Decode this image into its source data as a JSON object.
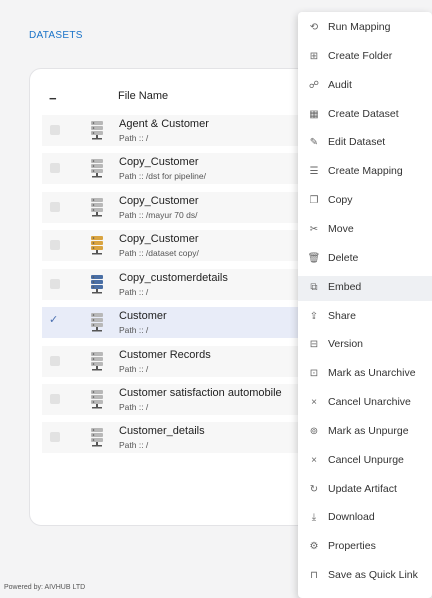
{
  "section_title": "DATASETS",
  "table": {
    "header_toggle": "−",
    "column_header": "File Name",
    "rows": [
      {
        "name": "Agent & Customer",
        "path": "Path :: /",
        "selected": false,
        "icon": "database-icon",
        "icon_color": "#b8b8b8"
      },
      {
        "name": "Copy_Customer",
        "path": "Path :: /dst for pipeline/",
        "selected": false,
        "icon": "database-icon",
        "icon_color": "#b8b8b8"
      },
      {
        "name": "Copy_Customer",
        "path": "Path :: /mayur 70 ds/",
        "selected": false,
        "icon": "database-icon",
        "icon_color": "#b8b8b8"
      },
      {
        "name": "Copy_Customer",
        "path": "Path :: /dataset copy/",
        "selected": false,
        "icon": "database-icon",
        "icon_color": "#d9a441"
      },
      {
        "name": "Copy_customerdetails",
        "path": "Path :: /",
        "selected": false,
        "icon": "database-icon",
        "icon_color": "#4a6fa5"
      },
      {
        "name": "Customer",
        "path": "Path :: /",
        "selected": true,
        "icon": "database-icon",
        "icon_color": "#b8b8b8"
      },
      {
        "name": "Customer Records",
        "path": "Path :: /",
        "selected": false,
        "icon": "database-icon",
        "icon_color": "#b8b8b8"
      },
      {
        "name": "Customer satisfaction automobile",
        "path": "Path :: /",
        "selected": false,
        "icon": "database-icon",
        "icon_color": "#b8b8b8"
      },
      {
        "name": "Customer_details",
        "path": "Path :: /",
        "selected": false,
        "icon": "database-icon",
        "icon_color": "#b8b8b8"
      }
    ],
    "selected_mark": "✓"
  },
  "context_menu": {
    "items": [
      {
        "label": "Run Mapping",
        "icon": "run-mapping-icon",
        "glyph": "⟲",
        "highlighted": false
      },
      {
        "label": "Create Folder",
        "icon": "folder-plus-icon",
        "glyph": "⊞",
        "highlighted": false
      },
      {
        "label": "Audit",
        "icon": "audit-icon",
        "glyph": "☍",
        "highlighted": false
      },
      {
        "label": "Create Dataset",
        "icon": "table-icon",
        "glyph": "▦",
        "highlighted": false
      },
      {
        "label": "Edit Dataset",
        "icon": "edit-icon",
        "glyph": "✎",
        "highlighted": false
      },
      {
        "label": "Create Mapping",
        "icon": "mapping-icon",
        "glyph": "☰",
        "highlighted": false
      },
      {
        "label": "Copy",
        "icon": "copy-icon",
        "glyph": "❐",
        "highlighted": false
      },
      {
        "label": "Move",
        "icon": "scissors-icon",
        "glyph": "✂",
        "highlighted": false
      },
      {
        "label": "Delete",
        "icon": "trash-icon",
        "glyph": "🗑",
        "highlighted": false
      },
      {
        "label": "Embed",
        "icon": "embed-icon",
        "glyph": "⧉",
        "highlighted": true
      },
      {
        "label": "Share",
        "icon": "share-icon",
        "glyph": "⇪",
        "highlighted": false
      },
      {
        "label": "Version",
        "icon": "version-icon",
        "glyph": "⊟",
        "highlighted": false
      },
      {
        "label": "Mark as Unarchive",
        "icon": "archive-icon",
        "glyph": "⊡",
        "highlighted": false
      },
      {
        "label": "Cancel Unarchive",
        "icon": "close-icon",
        "glyph": "×",
        "highlighted": false
      },
      {
        "label": "Mark as Unpurge",
        "icon": "unpurge-icon",
        "glyph": "⊚",
        "highlighted": false
      },
      {
        "label": "Cancel Unpurge",
        "icon": "close-icon",
        "glyph": "×",
        "highlighted": false
      },
      {
        "label": "Update Artifact",
        "icon": "refresh-icon",
        "glyph": "↻",
        "highlighted": false
      },
      {
        "label": "Download",
        "icon": "download-icon",
        "glyph": "⤓",
        "highlighted": false
      },
      {
        "label": "Properties",
        "icon": "gear-icon",
        "glyph": "⚙",
        "highlighted": false
      },
      {
        "label": "Save as Quick Link",
        "icon": "bookmark-icon",
        "glyph": "⊓",
        "highlighted": false
      }
    ]
  },
  "footer": "Powered by: AIVHUB LTD"
}
